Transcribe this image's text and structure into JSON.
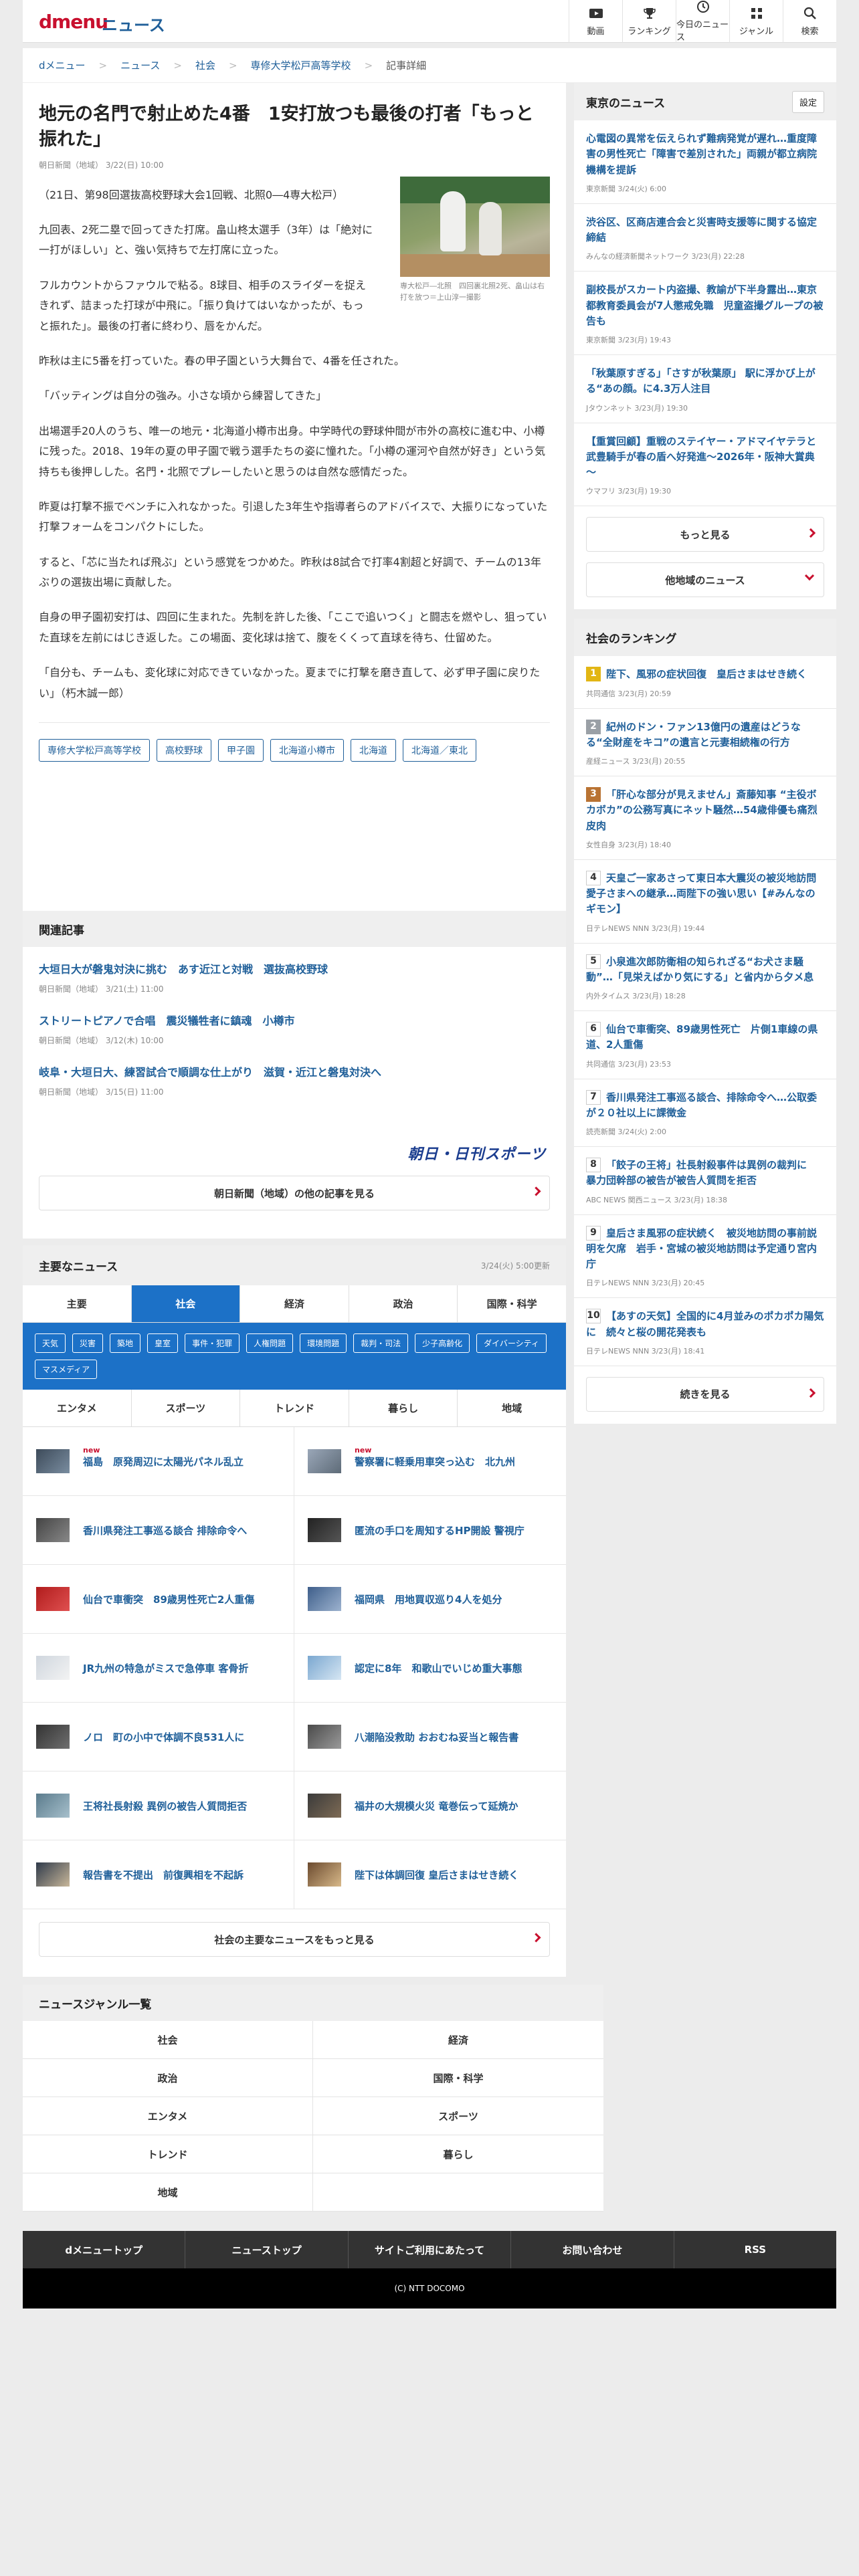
{
  "header": {
    "logo": "dmenu",
    "site": "ニュース",
    "nav": [
      {
        "label": "動画",
        "icon": "video-icon"
      },
      {
        "label": "ランキング",
        "icon": "trophy-icon"
      },
      {
        "label": "今日のニュース",
        "icon": "clock-icon"
      },
      {
        "label": "ジャンル",
        "icon": "grid-icon"
      },
      {
        "label": "検索",
        "icon": "search-icon"
      }
    ]
  },
  "breadcrumb": [
    "dメニュー",
    "ニュース",
    "社会",
    "専修大学松戸高等学校",
    "記事詳細"
  ],
  "article": {
    "headline": "地元の名門で射止めた4番　1安打放つも最後の打者「もっと振れた」",
    "byline": "朝日新聞（地域） 3/22(日) 10:00",
    "photo_caption": "専大松戸―北照　四回裏北照2死、畠山は右打を放つ＝上山淳一撮影",
    "paragraphs": [
      "（21日、第98回選抜高校野球大会1回戦、北照0―4専大松戸）",
      "九回表、2死二塁で回ってきた打席。畠山柊太選手（3年）は「絶対に一打がほしい」と、強い気持ちで左打席に立った。",
      "フルカウントからファウルで粘る。8球目、相手のスライダーを捉えきれず、詰まった打球が中飛に。「振り負けてはいなかったが、もっと振れた」。最後の打者に終わり、唇をかんだ。",
      "昨秋は主に5番を打っていた。春の甲子園という大舞台で、4番を任された。",
      "「バッティングは自分の強み。小さな頃から練習してきた」",
      "出場選手20人のうち、唯一の地元・北海道小樽市出身。中学時代の野球仲間が市外の高校に進む中、小樽に残った。2018、19年の夏の甲子園で戦う選手たちの姿に憧れた。「小樽の運河や自然が好き」という気持ちも後押しした。名門・北照でプレーしたいと思うのは自然な感情だった。",
      "昨夏は打撃不振でベンチに入れなかった。引退した3年生や指導者らのアドバイスで、大振りになっていた打撃フォームをコンパクトにした。",
      "すると、「芯に当たれば飛ぶ」という感覚をつかめた。昨秋は8試合で打率4割超と好調で、チームの13年ぶりの選抜出場に貢献した。",
      "自身の甲子園初安打は、四回に生まれた。先制を許した後、「ここで追いつく」と闘志を燃やし、狙っていた直球を左前にはじき返した。この場面、変化球は捨て、腹をくくって直球を待ち、仕留めた。",
      "「自分も、チームも、変化球に対応できていなかった。夏までに打撃を磨き直して、必ず甲子園に戻りたい」（朽木誠一郎）"
    ],
    "tags": [
      "専修大学松戸高等学校",
      "高校野球",
      "甲子園",
      "北海道小樽市",
      "北海道",
      "北海道／東北"
    ]
  },
  "related": {
    "title": "関連記事",
    "items": [
      {
        "title": "大垣日大が磐鬼対決に挑む　あす近江と対戦　選抜高校野球",
        "meta": "朝日新聞（地域） 3/21(土) 11:00"
      },
      {
        "title": "ストリートピアノで合唱　震災犠牲者に鎮魂　小樽市",
        "meta": "朝日新聞（地域） 3/12(木) 10:00"
      },
      {
        "title": "岐阜・大垣日大、練習試合で順調な仕上がり　滋賀・近江と磐鬼対決へ",
        "meta": "朝日新聞（地域） 3/15(日) 11:00"
      }
    ],
    "brand_logo": "朝日・日刊スポーツ",
    "more_button": "朝日新聞（地域）の他の記事を見る"
  },
  "main_news": {
    "title": "主要なニュース",
    "updated": "3/24(火) 5:00更新",
    "tabs": [
      "主要",
      "社会",
      "経済",
      "政治",
      "国際・科学"
    ],
    "chips": [
      "天気",
      "災害",
      "築地",
      "皇室",
      "事件・犯罪",
      "人権問題",
      "環境問題",
      "裁判・司法",
      "少子高齢化",
      "ダイバーシティ",
      "マスメディア"
    ],
    "tabs2": [
      "エンタメ",
      "スポーツ",
      "トレンド",
      "暮らし",
      "地域"
    ],
    "new_label": "new",
    "items": [
      {
        "title": "福島　原発周辺に太陽光パネル乱立",
        "new": true,
        "c1": "#3d4b5a",
        "c2": "#7a8da0"
      },
      {
        "title": "警察署に軽乗用車突っ込む　北九州",
        "new": true,
        "c1": "#9aa7b8",
        "c2": "#5e6b78"
      },
      {
        "title": "香川県発注工事巡る談合 排除命令へ",
        "new": false,
        "c1": "#444",
        "c2": "#888"
      },
      {
        "title": "匿流の手口を周知するHP開設 警視庁",
        "new": false,
        "c1": "#222",
        "c2": "#555"
      },
      {
        "title": "仙台で車衝突　89歳男性死亡2人重傷",
        "new": false,
        "c1": "#b01c1c",
        "c2": "#e05050"
      },
      {
        "title": "福岡県　用地買収巡り4人を処分",
        "new": false,
        "c1": "#3e5e8a",
        "c2": "#9db3cf"
      },
      {
        "title": "JR九州の特急がミスで急停車 客骨折",
        "new": false,
        "c1": "#cfd6de",
        "c2": "#f3f3f3"
      },
      {
        "title": "認定に8年　和歌山でいじめ重大事態",
        "new": false,
        "c1": "#7aa7d0",
        "c2": "#d6e6f3"
      },
      {
        "title": "ノロ　町の小中で体調不良531人に",
        "new": false,
        "c1": "#333",
        "c2": "#6f6f6f"
      },
      {
        "title": "八潮陥没救助 おおむね妥当と報告書",
        "new": false,
        "c1": "#4a4a4a",
        "c2": "#9a9a9a"
      },
      {
        "title": "王将社長射殺 異例の被告人質問拒否",
        "new": false,
        "c1": "#5a7b8c",
        "c2": "#a7c0cc"
      },
      {
        "title": "福井の大規模火災 竜巻伝って延焼か",
        "new": false,
        "c1": "#3a3a3a",
        "c2": "#7e6b55"
      },
      {
        "title": "報告書を不提出　前復興相を不起訴",
        "new": false,
        "c1": "#2f3a4a",
        "c2": "#c8b79a"
      },
      {
        "title": "陛下は体調回復 皇后さまはせき続く",
        "new": false,
        "c1": "#6b4a2e",
        "c2": "#d8b98a"
      }
    ],
    "more_button": "社会の主要なニュースをもっと見る"
  },
  "genre": {
    "title": "ニュースジャンル一覧",
    "items": [
      "社会",
      "経済",
      "政治",
      "国際・科学",
      "エンタメ",
      "スポーツ",
      "トレンド",
      "暮らし",
      "地域",
      ""
    ]
  },
  "footer": {
    "items": [
      "dメニュートップ",
      "ニューストップ",
      "サイトご利用にあたって",
      "お問い合わせ",
      "RSS"
    ],
    "copyright": "(C) NTT DOCOMO"
  },
  "tokyo": {
    "title": "東京のニュース",
    "settings": "設定",
    "items": [
      {
        "title": "心電図の異常を伝えられず難病発覚が遅れ…重度障害の男性死亡「障害で差別された」両親が都立病院機構を提訴",
        "meta": "東京新聞 3/24(火) 6:00"
      },
      {
        "title": "渋谷区、区商店連合会と災害時支援等に関する協定締結",
        "meta": "みんなの経済新聞ネットワーク 3/23(月) 22:28"
      },
      {
        "title": "副校長がスカート内盗撮、教諭が下半身露出…東京都教育委員会が7人懲戒免職　児童盗撮グループの被告も",
        "meta": "東京新聞 3/23(月) 19:43"
      },
      {
        "title": "「秋葉原すぎる」「さすが秋葉原」 駅に浮かび上がる“あの顔。に4.3万人注目",
        "meta": "Jタウンネット 3/23(月) 19:30"
      },
      {
        "title": "【重賞回顧】重戦のステイヤー・アドマイヤテラと武豊騎手が春の盾へ好発進～2026年・阪神大賞典～",
        "meta": "ウマフリ 3/23(月) 19:30"
      }
    ],
    "more": "もっと見る",
    "other": "他地域のニュース"
  },
  "ranking": {
    "title": "社会のランキング",
    "items": [
      {
        "title": "陛下、風邪の症状回復　皇后さまはせき続く",
        "meta": "共同通信 3/23(月) 20:59"
      },
      {
        "title": "紀州のドン・ファン13億円の遺産はどうなる“全財産をキコ”の遺言と元妻相続権の行方",
        "meta": "産経ニュース 3/23(月) 20:55"
      },
      {
        "title": "「肝心な部分が見えません」斎藤知事 “主役ボカボカ”の公務写真にネット騒然…54歳俳優も痛烈皮肉",
        "meta": "女性自身 3/23(月) 18:40"
      },
      {
        "title": "天皇ご一家あさって東日本大震災の被災地訪問　愛子さまへの継承…両陛下の強い思い【#みんなのギモン】",
        "meta": "日テレNEWS NNN 3/23(月) 19:44"
      },
      {
        "title": "小泉進次郎防衛相の知られざる“お犬さま騒動”…「見栄えばかり気にする」と省内から夕メ息",
        "meta": "内外タイムス 3/23(月) 18:28"
      },
      {
        "title": "仙台で車衝突、89歳男性死亡　片側1車線の県道、2人重傷",
        "meta": "共同通信 3/23(月) 23:53"
      },
      {
        "title": "香川県発注工事巡る談合、排除命令へ…公取委が２０社以上に課徴金",
        "meta": "読売新聞 3/24(火) 2:00"
      },
      {
        "title": "「餃子の王将」社長射殺事件は異例の裁判に　暴力団幹部の被告が被告人質問を拒否",
        "meta": "ABC NEWS 関西ニュース 3/23(月) 18:38"
      },
      {
        "title": "皇后さま風邪の症状続く　被災地訪問の事前説明を欠席　岩手・宮城の被災地訪問は予定通り宮内庁",
        "meta": "日テレNEWS NNN 3/23(月) 20:45"
      },
      {
        "title": "【あすの天気】全国的に4月並みのポカポカ陽気に　続々と桜の開花発表も",
        "meta": "日テレNEWS NNN 3/23(月) 18:41"
      }
    ],
    "more": "続きを見る"
  }
}
